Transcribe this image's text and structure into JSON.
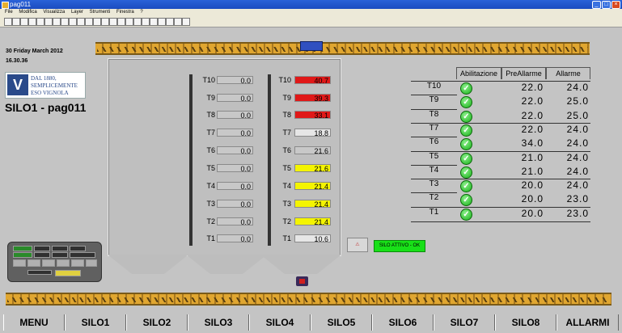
{
  "window": {
    "title": "pag011"
  },
  "menu": [
    "File",
    "Modifica",
    "Visualizza",
    "Layer",
    "Strumenti",
    "Finestra",
    "?"
  ],
  "header": {
    "date": "30 Friday March 2012",
    "time": "16.30.36"
  },
  "logo": {
    "line1": "DAL 1880,",
    "line2": "SEMPLICEMENTE",
    "line3": "ESO VIGNOLA"
  },
  "page_title": "SILO1 - pag011",
  "silo_left": [
    {
      "label": "T10",
      "value": "0.0"
    },
    {
      "label": "T9",
      "value": "0.0"
    },
    {
      "label": "T8",
      "value": "0.0"
    },
    {
      "label": "T7",
      "value": "0.0"
    },
    {
      "label": "T6",
      "value": "0.0"
    },
    {
      "label": "T5",
      "value": "0.0"
    },
    {
      "label": "T4",
      "value": "0.0"
    },
    {
      "label": "T3",
      "value": "0.0"
    },
    {
      "label": "T2",
      "value": "0.0"
    },
    {
      "label": "T1",
      "value": "0.0"
    }
  ],
  "silo_right": [
    {
      "label": "T10",
      "value": "40.7",
      "status": "red"
    },
    {
      "label": "T9",
      "value": "39.3",
      "status": "red"
    },
    {
      "label": "T8",
      "value": "33.1",
      "status": "red"
    },
    {
      "label": "T7",
      "value": "18.8",
      "status": "normal"
    },
    {
      "label": "T6",
      "value": "21.6",
      "status": "grey"
    },
    {
      "label": "T5",
      "value": "21.6",
      "status": "yellow"
    },
    {
      "label": "T4",
      "value": "21.4",
      "status": "yellow"
    },
    {
      "label": "T3",
      "value": "21.4",
      "status": "yellow"
    },
    {
      "label": "T2",
      "value": "21.4",
      "status": "yellow"
    },
    {
      "label": "T1",
      "value": "10.6",
      "status": "normal"
    }
  ],
  "green_button": {
    "label": "SILO ATTIVO - OK"
  },
  "alarm_table": {
    "headers": [
      "Abilitazione",
      "PreAllarme",
      "Allarme"
    ],
    "rows": [
      {
        "label": "T10",
        "pre": "22.0",
        "alarm": "24.0"
      },
      {
        "label": "T9",
        "pre": "22.0",
        "alarm": "25.0"
      },
      {
        "label": "T8",
        "pre": "22.0",
        "alarm": "25.0"
      },
      {
        "label": "T7",
        "pre": "22.0",
        "alarm": "24.0"
      },
      {
        "label": "T6",
        "pre": "34.0",
        "alarm": "24.0"
      },
      {
        "label": "T5",
        "pre": "21.0",
        "alarm": "24.0"
      },
      {
        "label": "T4",
        "pre": "21.0",
        "alarm": "24.0"
      },
      {
        "label": "T3",
        "pre": "20.0",
        "alarm": "24.0"
      },
      {
        "label": "T2",
        "pre": "20.0",
        "alarm": "23.0"
      },
      {
        "label": "T1",
        "pre": "20.0",
        "alarm": "23.0"
      }
    ]
  },
  "nav": [
    "MENU",
    "SILO1",
    "SILO2",
    "SILO3",
    "SILO4",
    "SILO5",
    "SILO6",
    "SILO7",
    "SILO8",
    "ALLARMI"
  ],
  "colors": {
    "red": "#e01818",
    "yellow": "#f4f400",
    "green": "#18e018",
    "conveyor": "#e0a630"
  }
}
